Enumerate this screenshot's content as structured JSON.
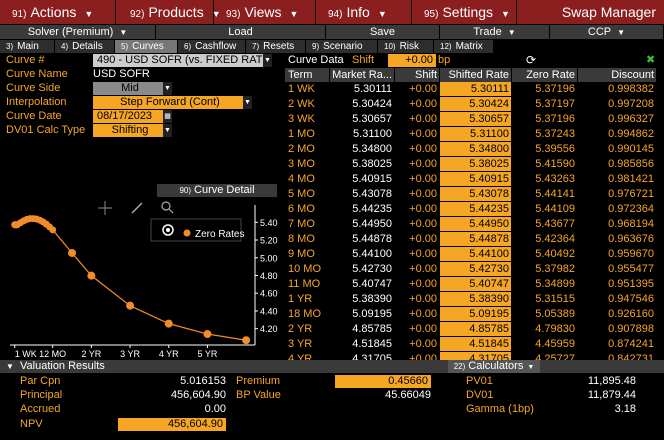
{
  "menu": {
    "items": [
      {
        "num": "91)",
        "label": "Actions"
      },
      {
        "num": "92)",
        "label": "Products"
      },
      {
        "num": "93)",
        "label": "Views"
      },
      {
        "num": "94)",
        "label": "Info"
      },
      {
        "num": "95)",
        "label": "Settings"
      }
    ],
    "app_name": "Swap Manager"
  },
  "toolbar": {
    "solver": "Solver (Premium)",
    "load": "Load",
    "save": "Save",
    "trade": "Trade",
    "ccp": "CCP"
  },
  "tabs": [
    {
      "num": "3)",
      "label": "Main"
    },
    {
      "num": "4)",
      "label": "Details"
    },
    {
      "num": "5)",
      "label": "Curves"
    },
    {
      "num": "6)",
      "label": "Cashflow"
    },
    {
      "num": "7)",
      "label": "Resets"
    },
    {
      "num": "9)",
      "label": "Scenario"
    },
    {
      "num": "10)",
      "label": "Risk"
    },
    {
      "num": "12)",
      "label": "Matrix"
    }
  ],
  "form": {
    "curve_num_label": "Curve #",
    "curve_num_value": "490 - USD SOFR (vs. FIXED RATE",
    "curve_name_label": "Curve Name",
    "curve_name_value": "USD SOFR",
    "curve_side_label": "Curve Side",
    "curve_side_value": "Mid",
    "interp_label": "Interpolation",
    "interp_value": "Step Forward (Cont)",
    "curve_date_label": "Curve Date",
    "curve_date_value": "08/17/2023",
    "dv01_label": "DV01 Calc Type",
    "dv01_value": "Shifting"
  },
  "curve_data": {
    "title": "Curve Data",
    "shift_label": "Shift",
    "shift_value": "+0.00",
    "shift_unit": "bp"
  },
  "curve_detail": {
    "num": "90)",
    "label": "Curve Detail",
    "legend": "Zero Rates"
  },
  "table": {
    "columns": [
      "Term",
      "Market Ra...",
      "Shift",
      "Shifted Rate",
      "Zero Rate",
      "Discount"
    ],
    "rows": [
      [
        "1 WK",
        "5.30111",
        "+0.00",
        "5.30111",
        "5.37196",
        "0.998382"
      ],
      [
        "2 WK",
        "5.30424",
        "+0.00",
        "5.30424",
        "5.37197",
        "0.997208"
      ],
      [
        "3 WK",
        "5.30657",
        "+0.00",
        "5.30657",
        "5.37196",
        "0.996327"
      ],
      [
        "1 MO",
        "5.31100",
        "+0.00",
        "5.31100",
        "5.37243",
        "0.994862"
      ],
      [
        "2 MO",
        "5.34800",
        "+0.00",
        "5.34800",
        "5.39556",
        "0.990145"
      ],
      [
        "3 MO",
        "5.38025",
        "+0.00",
        "5.38025",
        "5.41590",
        "0.985856"
      ],
      [
        "4 MO",
        "5.40915",
        "+0.00",
        "5.40915",
        "5.43263",
        "0.981421"
      ],
      [
        "5 MO",
        "5.43078",
        "+0.00",
        "5.43078",
        "5.44141",
        "0.976721"
      ],
      [
        "6 MO",
        "5.44235",
        "+0.00",
        "5.44235",
        "5.44109",
        "0.972364"
      ],
      [
        "7 MO",
        "5.44950",
        "+0.00",
        "5.44950",
        "5.43677",
        "0.968194"
      ],
      [
        "8 MO",
        "5.44878",
        "+0.00",
        "5.44878",
        "5.42364",
        "0.963676"
      ],
      [
        "9 MO",
        "5.44100",
        "+0.00",
        "5.44100",
        "5.40492",
        "0.959670"
      ],
      [
        "10 MO",
        "5.42730",
        "+0.00",
        "5.42730",
        "5.37982",
        "0.955477"
      ],
      [
        "11 MO",
        "5.40747",
        "+0.00",
        "5.40747",
        "5.34899",
        "0.951395"
      ],
      [
        "1 YR",
        "5.38390",
        "+0.00",
        "5.38390",
        "5.31515",
        "0.947546"
      ],
      [
        "18 MO",
        "5.09195",
        "+0.00",
        "5.09195",
        "5.05389",
        "0.926160"
      ],
      [
        "2 YR",
        "4.85785",
        "+0.00",
        "4.85785",
        "4.79830",
        "0.907898"
      ],
      [
        "3 YR",
        "4.51845",
        "+0.00",
        "4.51845",
        "4.45959",
        "0.874241"
      ],
      [
        "4 YR",
        "4.31705",
        "+0.00",
        "4.31705",
        "4.25727",
        "0.842731"
      ]
    ]
  },
  "valuation": {
    "title": "Valuation Results",
    "calculators_num": "22)",
    "calculators_label": "Calculators",
    "par_cpn_label": "Par Cpn",
    "par_cpn_value": "5.016153",
    "principal_label": "Principal",
    "principal_value": "456,604.90",
    "accrued_label": "Accrued",
    "accrued_value": "0.00",
    "npv_label": "NPV",
    "npv_value": "456,604.90",
    "premium_label": "Premium",
    "premium_value": "0.45660",
    "bp_value_label": "BP Value",
    "bp_value_value": "45.66049",
    "pv01_label": "PV01",
    "pv01_value": "11,895.48",
    "dv01_label": "DV01",
    "dv01_value": "11,879.44",
    "gamma_label": "Gamma (1bp)",
    "gamma_value": "3.18"
  },
  "chart_data": {
    "type": "scatter",
    "series": [
      {
        "name": "Zero Rates",
        "x": [
          "1 WK",
          "2 WK",
          "3 WK",
          "1 MO",
          "2 MO",
          "3 MO",
          "4 MO",
          "5 MO",
          "6 MO",
          "7 MO",
          "8 MO",
          "9 MO",
          "10 MO",
          "11 MO",
          "1 YR",
          "18 MO",
          "2 YR",
          "3 YR",
          "4 YR",
          "5 YR",
          "6 YR"
        ],
        "x_years": [
          0.019,
          0.038,
          0.058,
          0.083,
          0.167,
          0.25,
          0.333,
          0.417,
          0.5,
          0.583,
          0.667,
          0.75,
          0.833,
          0.917,
          1.0,
          1.5,
          2.0,
          3.0,
          4.0,
          5.0,
          6.0
        ],
        "values": [
          5.37196,
          5.37197,
          5.37196,
          5.37243,
          5.39556,
          5.4159,
          5.43263,
          5.44141,
          5.44109,
          5.43677,
          5.42364,
          5.40492,
          5.37982,
          5.34899,
          5.31515,
          5.05389,
          4.7983,
          4.45959,
          4.25727,
          4.14,
          4.07
        ]
      }
    ],
    "x_ticks": [
      "1 WK",
      "12 MO",
      "2 YR",
      "3 YR",
      "4 YR",
      "5 YR"
    ],
    "y_ticks": [
      "4.20",
      "4.40",
      "4.60",
      "4.80",
      "5.00",
      "5.20",
      "5.40"
    ],
    "ylim": [
      4.05,
      5.55
    ],
    "grid": false,
    "legend": "top-right",
    "colors": {
      "series": "#f28c28"
    }
  },
  "colors": {
    "menu_bg": "#8b1e1e",
    "accent": "#f5a623",
    "bar_bg": "#3a3a3a"
  }
}
